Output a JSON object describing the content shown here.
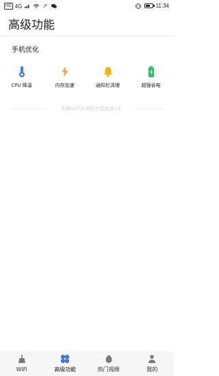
{
  "status_bar": {
    "network_label": "HD",
    "signal_label": "4G",
    "time": "11:34"
  },
  "page": {
    "title": "高级功能"
  },
  "section": {
    "title": "手机优化"
  },
  "features": [
    {
      "label": "CPU 降温",
      "icon": "thermometer-icon",
      "color": "#2f86f6"
    },
    {
      "label": "内存加速",
      "icon": "lightning-icon",
      "color": "#f5a623"
    },
    {
      "label": "通知栏清理",
      "icon": "bell-icon",
      "color": "#f6b400"
    },
    {
      "label": "超强省电",
      "icon": "battery-icon",
      "color": "#23c55e"
    }
  ],
  "notice": "无限WiFi大师已为您加速1天",
  "bottom_nav": [
    {
      "label": "WiFi",
      "icon": "broom-icon",
      "color": "#7a7a7a",
      "active": false
    },
    {
      "label": "高级功能",
      "icon": "four-petal-icon",
      "color": "#3d74e6",
      "active": true
    },
    {
      "label": "热门视频",
      "icon": "video-icon",
      "color": "#7a7a7a",
      "active": false
    },
    {
      "label": "我的",
      "icon": "user-icon",
      "color": "#7a7a7a",
      "active": false
    }
  ],
  "battery_level": 0.72,
  "colors": {
    "accent": "#3d74e6",
    "background": "#ffffff",
    "nav_background": "#f6f6f6"
  }
}
